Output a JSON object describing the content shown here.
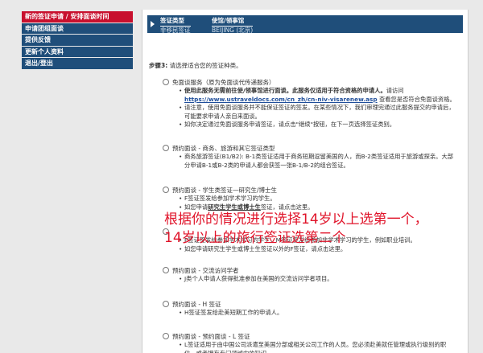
{
  "sidebar": {
    "items": [
      {
        "label": "新的签证申请 / 安排面谈时间"
      },
      {
        "label": "申请团组面谈"
      },
      {
        "label": "提供反馈"
      },
      {
        "label": "更新个人资料"
      },
      {
        "label": "退出/登出"
      }
    ]
  },
  "info_bar": {
    "visa_type_head": "签证类型",
    "visa_type_value": "非移民签证",
    "embassy_head": "使馆/领事馆",
    "embassy_value": "BEIJING (北京)"
  },
  "step": {
    "label": "步骤3:",
    "text": " 请选择适合您的签证种类。"
  },
  "options": {
    "waiver": {
      "title": "免面谈服务（原为免面谈代传递服务）",
      "b1_bold": "使用此服务无需前往使/领事馆进行面谈。此服务仅适用于符合资格的申请人。",
      "b1_pre": "请访问",
      "b1_link": "https://www.ustraveldocs.com/cn_zh/cn-niv-visarenew.asp",
      "b1_post": " 查看您是否符合免面谈资格。",
      "b2": "请注意，使用免面谈服务并不能保证签证的签发。在某些情况下，我们审理完通过此服务提交的申请后，可能要求申请人亲自来面谈。",
      "b3": "如你决定通过免面谈服务申请签证，请点击\"继续\"按钮，在下一页选择签证类别。"
    },
    "business": {
      "title": "预约面谈 - 商务、旅游和其它签证类型",
      "b1": "商务旅游签证(B1/B2): B-1类签证适用于商务短期逗留美国的人，而B-2类签证适用于旅游或探亲。大部分申请B-1或B-2类的申请人都会获签一张B-1/B-2的组合签证。"
    },
    "student": {
      "title": "预约面谈 - 学生类签证—研究生/博士生",
      "b1": "F签证签发给参加学术学习的学生。",
      "b2_pre": "如您申请",
      "b2_bold": "研究生学生或博士生",
      "b2_post": "签证，请点击这里。"
    },
    "student2": {
      "b1": "F签证签发给参加学术学习的学生，M签证签发给参加非学术学习的学生，例如职业培训。",
      "b2": "如您申请研究生学生或博士生签证以外的F签证，请点击这里。"
    },
    "exchange": {
      "title": "预约面谈 - 交流访问学者",
      "b1": "J类个人申请人获得批准参加在美国的交流访问学者项目。"
    },
    "h_visa": {
      "title": "预约面谈 - H 签证",
      "b1": "H签证签发给赴美短期工作的申请人。"
    },
    "l_visa": {
      "title": "预约面谈 - 预约面谈 - L 签证",
      "b1": "L签证适用于由中国公司派遣至美国分部或相关公司工作的人员。您必须赴美就任管理或执行级别的职位，或者拥有专门领域内的知识。"
    }
  },
  "overlay": {
    "line1": "根据你的情况进行选择14岁以上选第一个，",
    "line2": "14岁以上的旅行签证选第二个"
  }
}
